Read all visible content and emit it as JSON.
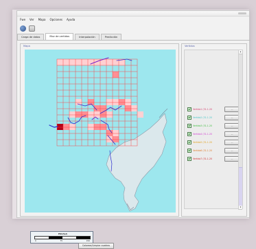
{
  "window": {
    "control_icon": "window-controls"
  },
  "menubar": {
    "items": [
      "Fwe",
      "Ver",
      "Mapa",
      "Opciones",
      "Ayuda"
    ]
  },
  "toolbar": {
    "icons": [
      "globe-icon",
      "grid-icon"
    ]
  },
  "tabs": [
    {
      "label": "Carga de datos",
      "active": false
    },
    {
      "label": "Mov de vertidos",
      "active": true
    },
    {
      "label": "Interpolación",
      "active": false
    },
    {
      "label": "Predicción",
      "active": false
    }
  ],
  "map_panel": {
    "title": "Mapa",
    "scale_title": "ESCALA",
    "scale_ticks": [
      "0",
      "75",
      "150"
    ],
    "button_label": "Colorear/Limpiar cuadros"
  },
  "vertidos_panel": {
    "title": "Vertidos",
    "rows": [
      {
        "label": "Vertido1 (31-1-2007)",
        "color": "#d43c6c",
        "button_label": "..."
      },
      {
        "label": "Vertido2 (31-1-2007)",
        "color": "#47c7c7",
        "button_label": "..."
      },
      {
        "label": "Vertido3 (31-1-2007)",
        "color": "#3fbe3f",
        "button_label": "..."
      },
      {
        "label": "Vertido4 (31-1-2007)",
        "color": "#d13fd1",
        "button_label": "..."
      },
      {
        "label": "Vertido5 (31-1-2007)",
        "color": "#e2a21e",
        "button_label": "..."
      },
      {
        "label": "Vertido6 (31-1-2007)",
        "color": "#df7a28",
        "button_label": "..."
      },
      {
        "label": "Vertido7 (31-1-2007)",
        "color": "#cf2d2d",
        "button_label": "..."
      }
    ]
  },
  "colors": {
    "map_background": "#9de7ee",
    "grid": "#ff3d3d",
    "grid_fill_light": "#ffd0d2",
    "grid_fill_dark": "#ff8f94",
    "grid_fill_strong": "#b50017",
    "track_blue": "#2b2bcf",
    "track_purple": "#7a23c9",
    "accent_blue": "#5560a8"
  }
}
